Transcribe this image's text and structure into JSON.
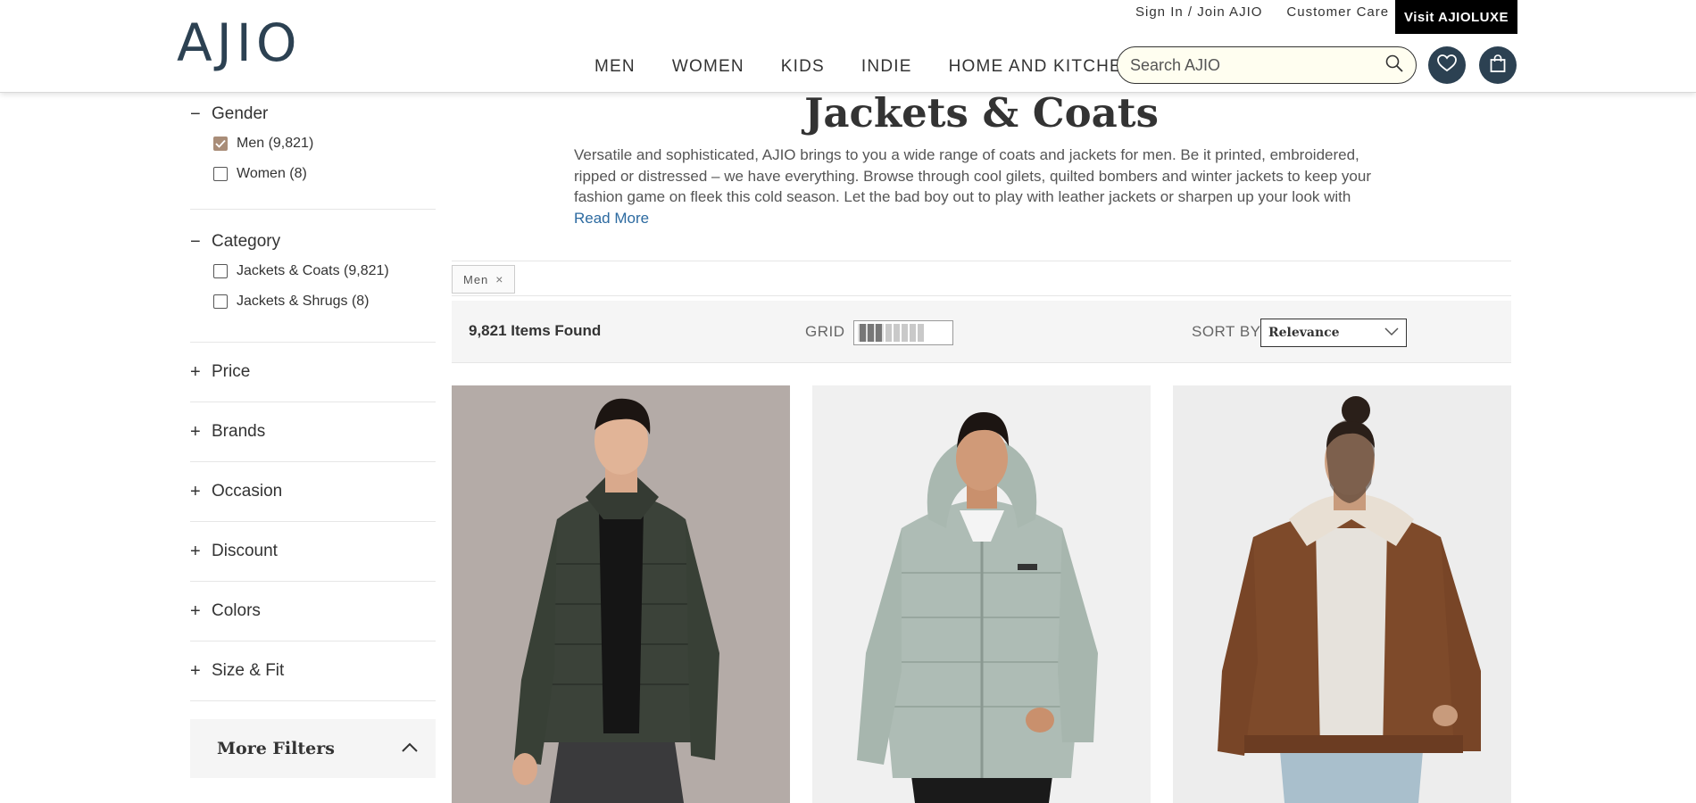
{
  "header": {
    "logo": "AJIO",
    "top_links": [
      "Sign In / Join AJIO",
      "Customer Care"
    ],
    "luxe_button": "Visit AJIOLUXE",
    "nav": [
      "MEN",
      "WOMEN",
      "KIDS",
      "INDIE",
      "HOME AND KITCHEN"
    ],
    "search_placeholder": "Search AJIO"
  },
  "sidebar": {
    "gender": {
      "title": "Gender",
      "toggle": "−",
      "options": [
        {
          "label": "Men (9,821)",
          "checked": true
        },
        {
          "label": "Women (8)",
          "checked": false
        }
      ]
    },
    "category": {
      "title": "Category",
      "toggle": "−",
      "options": [
        {
          "label": "Jackets & Coats (9,821)",
          "checked": false
        },
        {
          "label": "Jackets & Shrugs (8)",
          "checked": false
        }
      ]
    },
    "collapsed": [
      {
        "title": "Price",
        "toggle": "+"
      },
      {
        "title": "Brands",
        "toggle": "+"
      },
      {
        "title": "Occasion",
        "toggle": "+"
      },
      {
        "title": "Discount",
        "toggle": "+"
      },
      {
        "title": "Colors",
        "toggle": "+"
      },
      {
        "title": "Size & Fit",
        "toggle": "+"
      }
    ],
    "more_filters": "More Filters"
  },
  "main": {
    "title": "Jackets & Coats",
    "description": "Versatile and sophisticated, AJIO brings to you a wide range of coats and jackets for men. Be it printed, embroidered, ripped or distressed – we have everything. Browse through cool gilets, quilted bombers and winter jackets to keep your fashion game on fleek this cold season. Let the bad boy out to play with leather jackets or sharpen up your look with",
    "read_more": "Read More",
    "chip": "Men",
    "chip_remove": "×",
    "items_found": "9,821 Items Found",
    "grid_label": "GRID",
    "sort_label": "SORT BY",
    "sort_value": "Relevance"
  },
  "colors": {
    "brand": "#2c4152",
    "checkbox_checked": "#a98d78",
    "toolbar_bg": "#f5f5f5"
  },
  "products": [
    {
      "jacket": "dark green quilted puffer jacket"
    },
    {
      "jacket": "mint hooded puffer jacket"
    },
    {
      "jacket": "brown bomber jacket with sherpa collar"
    }
  ]
}
